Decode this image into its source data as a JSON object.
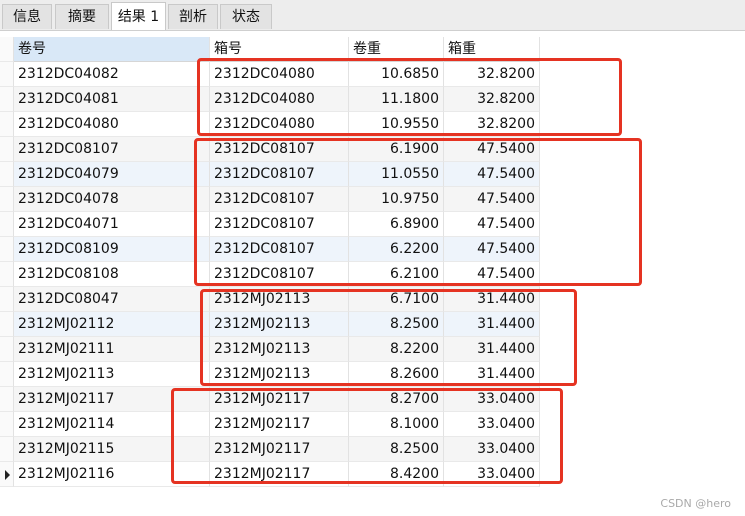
{
  "tabs": [
    {
      "label": "信息"
    },
    {
      "label": "摘要"
    },
    {
      "label": "结果 1"
    },
    {
      "label": "剖析"
    },
    {
      "label": "状态"
    }
  ],
  "columns": [
    "卷号",
    "箱号",
    "卷重",
    "箱重"
  ],
  "rows": [
    [
      "2312DC04082",
      "2312DC04080",
      "10.6850",
      "32.8200"
    ],
    [
      "2312DC04081",
      "2312DC04080",
      "11.1800",
      "32.8200"
    ],
    [
      "2312DC04080",
      "2312DC04080",
      "10.9550",
      "32.8200"
    ],
    [
      "2312DC08107",
      "2312DC08107",
      "6.1900",
      "47.5400"
    ],
    [
      "2312DC04079",
      "2312DC08107",
      "11.0550",
      "47.5400"
    ],
    [
      "2312DC04078",
      "2312DC08107",
      "10.9750",
      "47.5400"
    ],
    [
      "2312DC04071",
      "2312DC08107",
      "6.8900",
      "47.5400"
    ],
    [
      "2312DC08109",
      "2312DC08107",
      "6.2200",
      "47.5400"
    ],
    [
      "2312DC08108",
      "2312DC08107",
      "6.2100",
      "47.5400"
    ],
    [
      "2312DC08047",
      "2312MJ02113",
      "6.7100",
      "31.4400"
    ],
    [
      "2312MJ02112",
      "2312MJ02113",
      "8.2500",
      "31.4400"
    ],
    [
      "2312MJ02111",
      "2312MJ02113",
      "8.2200",
      "31.4400"
    ],
    [
      "2312MJ02113",
      "2312MJ02113",
      "8.2600",
      "31.4400"
    ],
    [
      "2312MJ02117",
      "2312MJ02117",
      "8.2700",
      "33.0400"
    ],
    [
      "2312MJ02114",
      "2312MJ02117",
      "8.1000",
      "33.0400"
    ],
    [
      "2312MJ02115",
      "2312MJ02117",
      "8.2500",
      "33.0400"
    ],
    [
      "2312MJ02116",
      "2312MJ02117",
      "8.4200",
      "33.0400"
    ]
  ],
  "watermark": "CSDN @hero",
  "colors": {
    "highlight": "#e53322",
    "header_selected": "#d9e8f7",
    "row_alt": "#f5f5f5",
    "row_blue": "#eef4fb"
  }
}
